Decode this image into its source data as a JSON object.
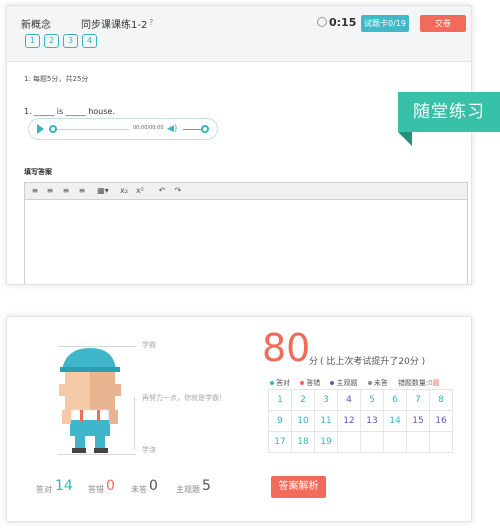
{
  "quiz": {
    "course": "新概念",
    "lesson_title": "同步课课练1-2",
    "help": "?",
    "question_numbers": [
      "1",
      "2",
      "3",
      "4"
    ],
    "timer": "0:15",
    "answer_card": "试题卡0/19",
    "submit": "交卷",
    "section_info": "1: 每题5分，共25分",
    "question_text": "1. _____ is _____ house.",
    "audio_time": "00:00/00:00",
    "answer_label": "填写答案"
  },
  "badge": "随堂练习",
  "result": {
    "score": "80",
    "score_unit": "分",
    "score_note": "( 比上次考试提升了20分 )",
    "legend": [
      {
        "label": "答对",
        "color": "#35b6c3"
      },
      {
        "label": "答错",
        "color": "#f26a5a"
      },
      {
        "label": "主观题",
        "color": "#5a5ab8"
      },
      {
        "label": "未答",
        "color": "#888888"
      }
    ],
    "wrong_count_label": "错题数量:",
    "wrong_count": "0题",
    "grid": [
      [
        {
          "n": "1",
          "s": "correct"
        },
        {
          "n": "2",
          "s": "correct"
        },
        {
          "n": "3",
          "s": "correct"
        },
        {
          "n": "4",
          "s": "subjective"
        },
        {
          "n": "5",
          "s": "correct"
        },
        {
          "n": "6",
          "s": "correct"
        },
        {
          "n": "7",
          "s": "correct"
        },
        {
          "n": "8",
          "s": "correct"
        }
      ],
      [
        {
          "n": "9",
          "s": "correct"
        },
        {
          "n": "10",
          "s": "correct"
        },
        {
          "n": "11",
          "s": "correct"
        },
        {
          "n": "12",
          "s": "subjective"
        },
        {
          "n": "13",
          "s": "subjective"
        },
        {
          "n": "14",
          "s": "correct"
        },
        {
          "n": "15",
          "s": "subjective"
        },
        {
          "n": "16",
          "s": "subjective"
        }
      ],
      [
        {
          "n": "17",
          "s": "correct"
        },
        {
          "n": "18",
          "s": "correct"
        },
        {
          "n": "19",
          "s": "correct"
        }
      ]
    ],
    "analysis_button": "答案解析",
    "mascot_labels": {
      "top": "学霸",
      "middle": "再努力一点，你就是学霸！",
      "bottom": "学渣"
    },
    "stats": [
      {
        "label": "答对",
        "value": "14",
        "color": "#35b6c3"
      },
      {
        "label": "答错",
        "value": "0",
        "color": "#f26a5a"
      },
      {
        "label": "未答",
        "value": "0",
        "color": "#555555"
      },
      {
        "label": "主观题",
        "value": "5",
        "color": "#555555"
      }
    ]
  }
}
